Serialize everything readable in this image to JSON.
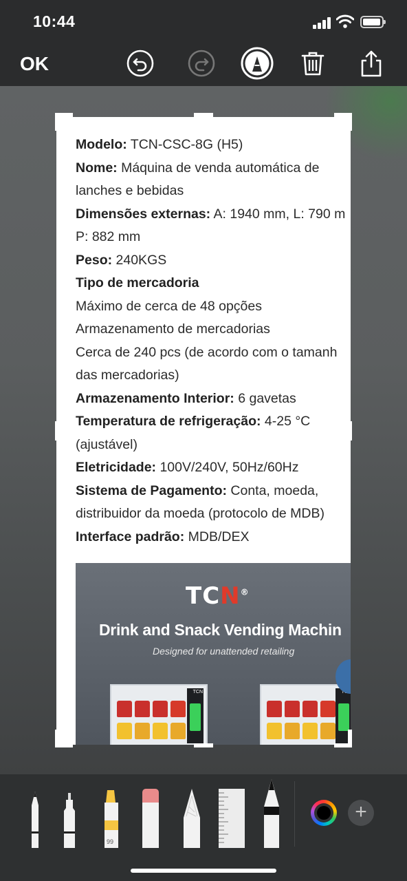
{
  "status": {
    "time": "10:44"
  },
  "toolbar": {
    "ok_label": "OK",
    "icons": [
      "undo-icon",
      "redo-icon",
      "markup-pen-icon",
      "trash-icon",
      "share-icon"
    ]
  },
  "document": {
    "lines": [
      {
        "bold": "Modelo:",
        "text": " TCN-CSC-8G (H5)"
      },
      {
        "bold": "Nome:",
        "text": " Máquina de venda automática de"
      },
      {
        "bold": "",
        "text": "lanches e bebidas"
      },
      {
        "bold": "Dimensões externas:",
        "text": " A: 1940 mm, L: 790 m"
      },
      {
        "bold": "",
        "text": "P: 882 mm"
      },
      {
        "bold": "Peso:",
        "text": " 240KGS"
      },
      {
        "bold": "Tipo de mercadoria",
        "text": ""
      },
      {
        "bold": "",
        "text": "Máximo de cerca de 48 opções"
      },
      {
        "bold": "",
        "text": "Armazenamento de mercadorias"
      },
      {
        "bold": "",
        "text": "Cerca de 240 pcs (de acordo com o tamanh"
      },
      {
        "bold": "",
        "text": "das mercadorias)"
      },
      {
        "bold": "Armazenamento Interior:",
        "text": " 6 gavetas"
      },
      {
        "bold": "Temperatura de refrigeração:",
        "text": " 4-25 °C"
      },
      {
        "bold": "",
        "text": "(ajustável)"
      },
      {
        "bold": "Eletricidade:",
        "text": " 100V/240V, 50Hz/60Hz"
      },
      {
        "bold": "Sistema de Pagamento:",
        "text": " Conta, moeda,"
      },
      {
        "bold": "",
        "text": "distribuidor da moeda (protocolo de MDB)"
      },
      {
        "bold": "Interface padrão:",
        "text": " MDB/DEX"
      }
    ],
    "promo": {
      "brand_tc": "TC",
      "brand_n": "N",
      "brand_mark": "®",
      "title": "Drink and Snack Vending Machin",
      "subtitle": "Designed for unattended retailing",
      "machine_label": "TCN"
    }
  },
  "tools": {
    "items": [
      "pen-tool",
      "monoline-tool",
      "highlighter-tool",
      "eraser-tool",
      "lasso-tool",
      "ruler-tool",
      "pencil-tool"
    ],
    "highlighter_opacity": "99",
    "colors": {
      "accent": "#f5c542",
      "eraser": "#e98b8b",
      "background": "#2e3031"
    }
  },
  "color_picker": {
    "icon": "color-wheel-icon"
  },
  "add_button": {
    "label": "+"
  }
}
